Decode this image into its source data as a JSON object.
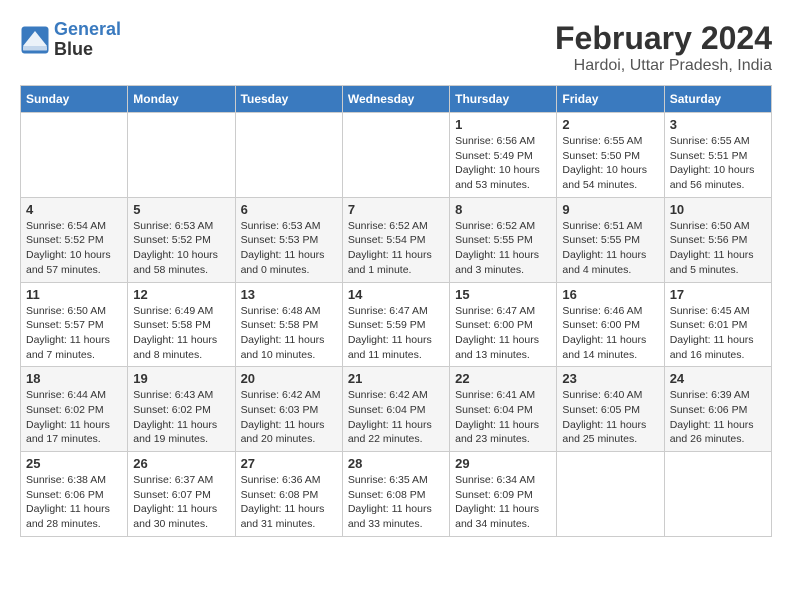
{
  "header": {
    "logo_line1": "General",
    "logo_line2": "Blue",
    "month": "February 2024",
    "location": "Hardoi, Uttar Pradesh, India"
  },
  "weekdays": [
    "Sunday",
    "Monday",
    "Tuesday",
    "Wednesday",
    "Thursday",
    "Friday",
    "Saturday"
  ],
  "weeks": [
    [
      {
        "day": "",
        "info": ""
      },
      {
        "day": "",
        "info": ""
      },
      {
        "day": "",
        "info": ""
      },
      {
        "day": "",
        "info": ""
      },
      {
        "day": "1",
        "info": "Sunrise: 6:56 AM\nSunset: 5:49 PM\nDaylight: 10 hours and 53 minutes."
      },
      {
        "day": "2",
        "info": "Sunrise: 6:55 AM\nSunset: 5:50 PM\nDaylight: 10 hours and 54 minutes."
      },
      {
        "day": "3",
        "info": "Sunrise: 6:55 AM\nSunset: 5:51 PM\nDaylight: 10 hours and 56 minutes."
      }
    ],
    [
      {
        "day": "4",
        "info": "Sunrise: 6:54 AM\nSunset: 5:52 PM\nDaylight: 10 hours and 57 minutes."
      },
      {
        "day": "5",
        "info": "Sunrise: 6:53 AM\nSunset: 5:52 PM\nDaylight: 10 hours and 58 minutes."
      },
      {
        "day": "6",
        "info": "Sunrise: 6:53 AM\nSunset: 5:53 PM\nDaylight: 11 hours and 0 minutes."
      },
      {
        "day": "7",
        "info": "Sunrise: 6:52 AM\nSunset: 5:54 PM\nDaylight: 11 hours and 1 minute."
      },
      {
        "day": "8",
        "info": "Sunrise: 6:52 AM\nSunset: 5:55 PM\nDaylight: 11 hours and 3 minutes."
      },
      {
        "day": "9",
        "info": "Sunrise: 6:51 AM\nSunset: 5:55 PM\nDaylight: 11 hours and 4 minutes."
      },
      {
        "day": "10",
        "info": "Sunrise: 6:50 AM\nSunset: 5:56 PM\nDaylight: 11 hours and 5 minutes."
      }
    ],
    [
      {
        "day": "11",
        "info": "Sunrise: 6:50 AM\nSunset: 5:57 PM\nDaylight: 11 hours and 7 minutes."
      },
      {
        "day": "12",
        "info": "Sunrise: 6:49 AM\nSunset: 5:58 PM\nDaylight: 11 hours and 8 minutes."
      },
      {
        "day": "13",
        "info": "Sunrise: 6:48 AM\nSunset: 5:58 PM\nDaylight: 11 hours and 10 minutes."
      },
      {
        "day": "14",
        "info": "Sunrise: 6:47 AM\nSunset: 5:59 PM\nDaylight: 11 hours and 11 minutes."
      },
      {
        "day": "15",
        "info": "Sunrise: 6:47 AM\nSunset: 6:00 PM\nDaylight: 11 hours and 13 minutes."
      },
      {
        "day": "16",
        "info": "Sunrise: 6:46 AM\nSunset: 6:00 PM\nDaylight: 11 hours and 14 minutes."
      },
      {
        "day": "17",
        "info": "Sunrise: 6:45 AM\nSunset: 6:01 PM\nDaylight: 11 hours and 16 minutes."
      }
    ],
    [
      {
        "day": "18",
        "info": "Sunrise: 6:44 AM\nSunset: 6:02 PM\nDaylight: 11 hours and 17 minutes."
      },
      {
        "day": "19",
        "info": "Sunrise: 6:43 AM\nSunset: 6:02 PM\nDaylight: 11 hours and 19 minutes."
      },
      {
        "day": "20",
        "info": "Sunrise: 6:42 AM\nSunset: 6:03 PM\nDaylight: 11 hours and 20 minutes."
      },
      {
        "day": "21",
        "info": "Sunrise: 6:42 AM\nSunset: 6:04 PM\nDaylight: 11 hours and 22 minutes."
      },
      {
        "day": "22",
        "info": "Sunrise: 6:41 AM\nSunset: 6:04 PM\nDaylight: 11 hours and 23 minutes."
      },
      {
        "day": "23",
        "info": "Sunrise: 6:40 AM\nSunset: 6:05 PM\nDaylight: 11 hours and 25 minutes."
      },
      {
        "day": "24",
        "info": "Sunrise: 6:39 AM\nSunset: 6:06 PM\nDaylight: 11 hours and 26 minutes."
      }
    ],
    [
      {
        "day": "25",
        "info": "Sunrise: 6:38 AM\nSunset: 6:06 PM\nDaylight: 11 hours and 28 minutes."
      },
      {
        "day": "26",
        "info": "Sunrise: 6:37 AM\nSunset: 6:07 PM\nDaylight: 11 hours and 30 minutes."
      },
      {
        "day": "27",
        "info": "Sunrise: 6:36 AM\nSunset: 6:08 PM\nDaylight: 11 hours and 31 minutes."
      },
      {
        "day": "28",
        "info": "Sunrise: 6:35 AM\nSunset: 6:08 PM\nDaylight: 11 hours and 33 minutes."
      },
      {
        "day": "29",
        "info": "Sunrise: 6:34 AM\nSunset: 6:09 PM\nDaylight: 11 hours and 34 minutes."
      },
      {
        "day": "",
        "info": ""
      },
      {
        "day": "",
        "info": ""
      }
    ]
  ]
}
